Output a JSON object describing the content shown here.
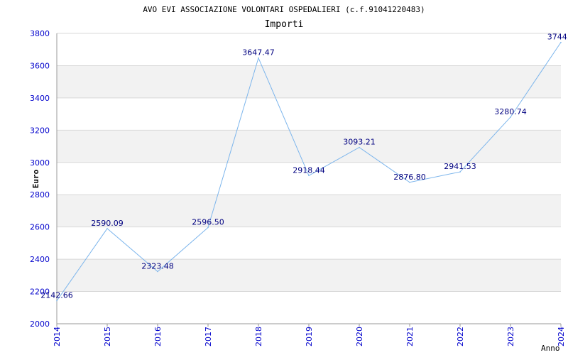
{
  "chart_data": {
    "type": "line",
    "title": "AVO EVI ASSOCIAZIONE VOLONTARI OSPEDALIERI (c.f.91041220483)",
    "subtitle": "Importi",
    "xlabel": "Anno",
    "ylabel": "Euro",
    "ylim": [
      2000,
      3800
    ],
    "yticks": [
      2000,
      2200,
      2400,
      2600,
      2800,
      3000,
      3200,
      3400,
      3600,
      3800
    ],
    "grid": "horizontal alternating bands",
    "categories": [
      "2014",
      "2015",
      "2016",
      "2017",
      "2018",
      "2019",
      "2020",
      "2021",
      "2022",
      "2023",
      "2024"
    ],
    "values": [
      2142.66,
      2590.09,
      2323.48,
      2596.5,
      3647.47,
      2918.44,
      3093.21,
      2876.8,
      2941.53,
      3280.74,
      3744.4
    ],
    "value_labels": [
      "2142.66",
      "2590.09",
      "2323.48",
      "2596.50",
      "3647.47",
      "2918.44",
      "3093.21",
      "2876.80",
      "2941.53",
      "3280.74",
      "3744.4"
    ],
    "colors": {
      "line": "#7cb5ec",
      "label": "#000080",
      "tick": "#0000cc",
      "band": "#f2f2f2",
      "gridline": "#d8d8d8",
      "axis": "#999999",
      "title": "#000000",
      "subtitle": "#333333"
    }
  }
}
